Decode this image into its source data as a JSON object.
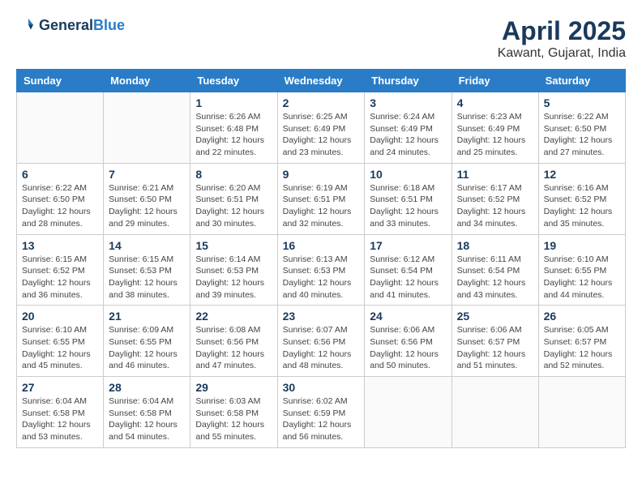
{
  "header": {
    "logo_line1": "General",
    "logo_line2": "Blue",
    "title": "April 2025",
    "subtitle": "Kawant, Gujarat, India"
  },
  "weekdays": [
    "Sunday",
    "Monday",
    "Tuesday",
    "Wednesday",
    "Thursday",
    "Friday",
    "Saturday"
  ],
  "weeks": [
    [
      {
        "day": "",
        "info": ""
      },
      {
        "day": "",
        "info": ""
      },
      {
        "day": "1",
        "info": "Sunrise: 6:26 AM\nSunset: 6:48 PM\nDaylight: 12 hours and 22 minutes."
      },
      {
        "day": "2",
        "info": "Sunrise: 6:25 AM\nSunset: 6:49 PM\nDaylight: 12 hours and 23 minutes."
      },
      {
        "day": "3",
        "info": "Sunrise: 6:24 AM\nSunset: 6:49 PM\nDaylight: 12 hours and 24 minutes."
      },
      {
        "day": "4",
        "info": "Sunrise: 6:23 AM\nSunset: 6:49 PM\nDaylight: 12 hours and 25 minutes."
      },
      {
        "day": "5",
        "info": "Sunrise: 6:22 AM\nSunset: 6:50 PM\nDaylight: 12 hours and 27 minutes."
      }
    ],
    [
      {
        "day": "6",
        "info": "Sunrise: 6:22 AM\nSunset: 6:50 PM\nDaylight: 12 hours and 28 minutes."
      },
      {
        "day": "7",
        "info": "Sunrise: 6:21 AM\nSunset: 6:50 PM\nDaylight: 12 hours and 29 minutes."
      },
      {
        "day": "8",
        "info": "Sunrise: 6:20 AM\nSunset: 6:51 PM\nDaylight: 12 hours and 30 minutes."
      },
      {
        "day": "9",
        "info": "Sunrise: 6:19 AM\nSunset: 6:51 PM\nDaylight: 12 hours and 32 minutes."
      },
      {
        "day": "10",
        "info": "Sunrise: 6:18 AM\nSunset: 6:51 PM\nDaylight: 12 hours and 33 minutes."
      },
      {
        "day": "11",
        "info": "Sunrise: 6:17 AM\nSunset: 6:52 PM\nDaylight: 12 hours and 34 minutes."
      },
      {
        "day": "12",
        "info": "Sunrise: 6:16 AM\nSunset: 6:52 PM\nDaylight: 12 hours and 35 minutes."
      }
    ],
    [
      {
        "day": "13",
        "info": "Sunrise: 6:15 AM\nSunset: 6:52 PM\nDaylight: 12 hours and 36 minutes."
      },
      {
        "day": "14",
        "info": "Sunrise: 6:15 AM\nSunset: 6:53 PM\nDaylight: 12 hours and 38 minutes."
      },
      {
        "day": "15",
        "info": "Sunrise: 6:14 AM\nSunset: 6:53 PM\nDaylight: 12 hours and 39 minutes."
      },
      {
        "day": "16",
        "info": "Sunrise: 6:13 AM\nSunset: 6:53 PM\nDaylight: 12 hours and 40 minutes."
      },
      {
        "day": "17",
        "info": "Sunrise: 6:12 AM\nSunset: 6:54 PM\nDaylight: 12 hours and 41 minutes."
      },
      {
        "day": "18",
        "info": "Sunrise: 6:11 AM\nSunset: 6:54 PM\nDaylight: 12 hours and 43 minutes."
      },
      {
        "day": "19",
        "info": "Sunrise: 6:10 AM\nSunset: 6:55 PM\nDaylight: 12 hours and 44 minutes."
      }
    ],
    [
      {
        "day": "20",
        "info": "Sunrise: 6:10 AM\nSunset: 6:55 PM\nDaylight: 12 hours and 45 minutes."
      },
      {
        "day": "21",
        "info": "Sunrise: 6:09 AM\nSunset: 6:55 PM\nDaylight: 12 hours and 46 minutes."
      },
      {
        "day": "22",
        "info": "Sunrise: 6:08 AM\nSunset: 6:56 PM\nDaylight: 12 hours and 47 minutes."
      },
      {
        "day": "23",
        "info": "Sunrise: 6:07 AM\nSunset: 6:56 PM\nDaylight: 12 hours and 48 minutes."
      },
      {
        "day": "24",
        "info": "Sunrise: 6:06 AM\nSunset: 6:56 PM\nDaylight: 12 hours and 50 minutes."
      },
      {
        "day": "25",
        "info": "Sunrise: 6:06 AM\nSunset: 6:57 PM\nDaylight: 12 hours and 51 minutes."
      },
      {
        "day": "26",
        "info": "Sunrise: 6:05 AM\nSunset: 6:57 PM\nDaylight: 12 hours and 52 minutes."
      }
    ],
    [
      {
        "day": "27",
        "info": "Sunrise: 6:04 AM\nSunset: 6:58 PM\nDaylight: 12 hours and 53 minutes."
      },
      {
        "day": "28",
        "info": "Sunrise: 6:04 AM\nSunset: 6:58 PM\nDaylight: 12 hours and 54 minutes."
      },
      {
        "day": "29",
        "info": "Sunrise: 6:03 AM\nSunset: 6:58 PM\nDaylight: 12 hours and 55 minutes."
      },
      {
        "day": "30",
        "info": "Sunrise: 6:02 AM\nSunset: 6:59 PM\nDaylight: 12 hours and 56 minutes."
      },
      {
        "day": "",
        "info": ""
      },
      {
        "day": "",
        "info": ""
      },
      {
        "day": "",
        "info": ""
      }
    ]
  ]
}
